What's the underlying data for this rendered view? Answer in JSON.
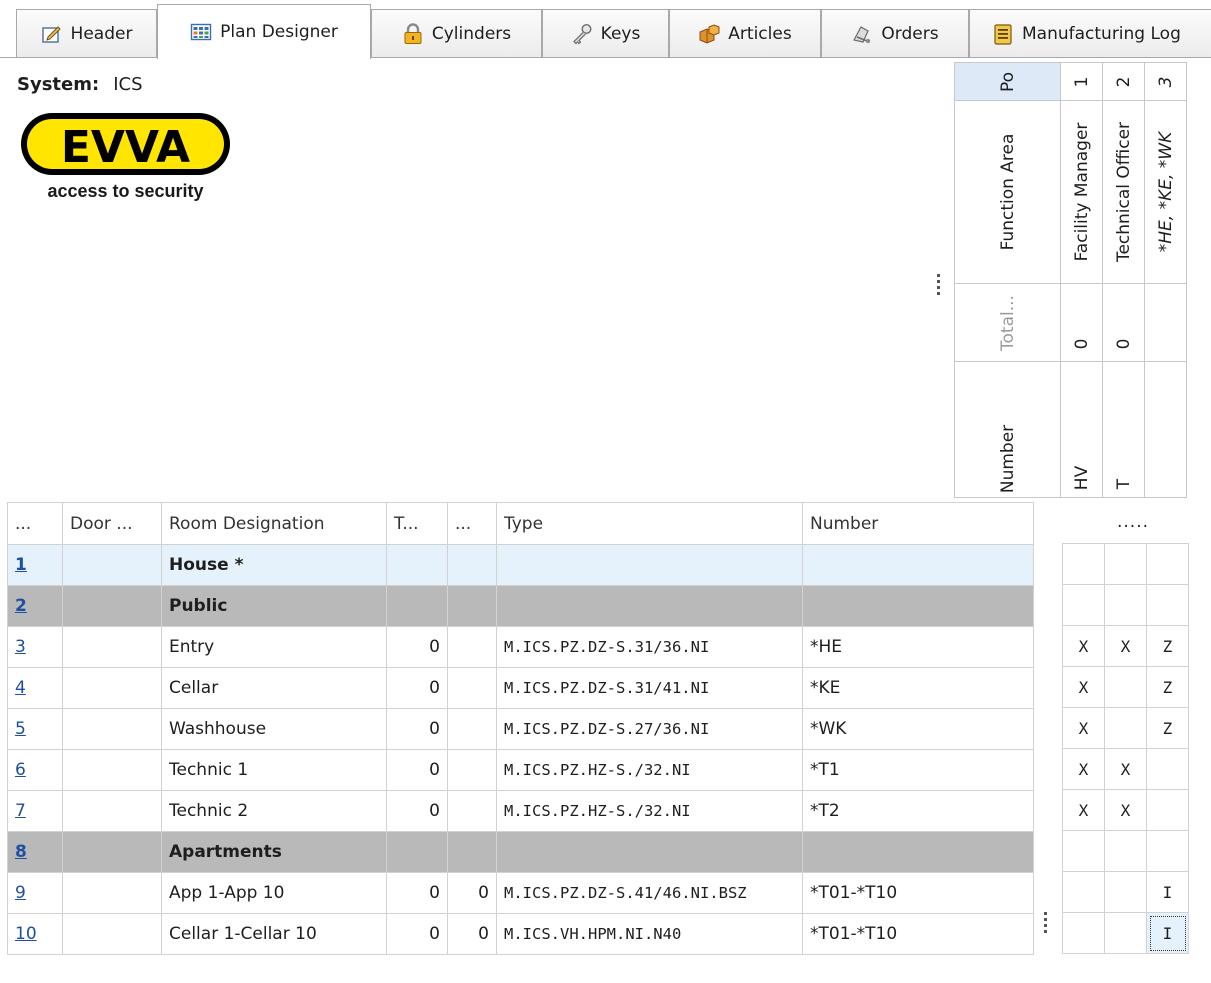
{
  "tabs": [
    {
      "label": "Header",
      "icon": "edit-icon"
    },
    {
      "label": "Plan Designer",
      "icon": "grid-icon",
      "active": true
    },
    {
      "label": "Cylinders",
      "icon": "padlock-icon"
    },
    {
      "label": "Keys",
      "icon": "key-icon"
    },
    {
      "label": "Articles",
      "icon": "boxes-icon"
    },
    {
      "label": "Orders",
      "icon": "truck-icon"
    },
    {
      "label": "Manufacturing Log",
      "icon": "log-icon"
    }
  ],
  "system": {
    "label": "System:",
    "value": "ICS"
  },
  "logo": {
    "brand": "EVVA",
    "tagline": "access to security",
    "accent": "#ffe500"
  },
  "matrix_header": {
    "row_labels": {
      "po": "Po",
      "function_area": "Function Area",
      "total": "Total...",
      "number": "Number"
    },
    "columns": [
      {
        "po": "1",
        "function_area": "Facility Manager",
        "total": "0",
        "number": "HV",
        "italic": false
      },
      {
        "po": "2",
        "function_area": "Technical Officer",
        "total": "0",
        "number": "T",
        "italic": false
      },
      {
        "po": "3",
        "function_area": "*HE, *KE, *WK",
        "total": "",
        "number": "",
        "italic": true
      }
    ]
  },
  "grid": {
    "headers": [
      "...",
      "Door ...",
      "Room Designation",
      "T...",
      "...",
      "Type",
      "Number"
    ],
    "rows": [
      {
        "idx": "1",
        "door": "",
        "room": "House *",
        "t": "",
        "c": "",
        "type": "",
        "number": "",
        "kind": "house",
        "marks": [
          "",
          "",
          ""
        ]
      },
      {
        "idx": "2",
        "door": "",
        "room": "Public",
        "t": "",
        "c": "",
        "type": "",
        "number": "",
        "kind": "group",
        "marks": [
          "",
          "",
          ""
        ]
      },
      {
        "idx": "3",
        "door": "",
        "room": "Entry",
        "t": "0",
        "c": "",
        "type": "M.ICS.PZ.DZ-S.31/36.NI",
        "number": "*HE",
        "kind": "row",
        "marks": [
          "X",
          "X",
          "Z"
        ]
      },
      {
        "idx": "4",
        "door": "",
        "room": "Cellar",
        "t": "0",
        "c": "",
        "type": "M.ICS.PZ.DZ-S.31/41.NI",
        "number": "*KE",
        "kind": "row",
        "marks": [
          "X",
          "",
          "Z"
        ]
      },
      {
        "idx": "5",
        "door": "",
        "room": "Washhouse",
        "t": "0",
        "c": "",
        "type": "M.ICS.PZ.DZ-S.27/36.NI",
        "number": "*WK",
        "kind": "row",
        "marks": [
          "X",
          "",
          "Z"
        ]
      },
      {
        "idx": "6",
        "door": "",
        "room": "Technic 1",
        "t": "0",
        "c": "",
        "type": "M.ICS.PZ.HZ-S./32.NI",
        "number": "*T1",
        "kind": "row",
        "marks": [
          "X",
          "X",
          ""
        ]
      },
      {
        "idx": "7",
        "door": "",
        "room": "Technic 2",
        "t": "0",
        "c": "",
        "type": "M.ICS.PZ.HZ-S./32.NI",
        "number": "*T2",
        "kind": "row",
        "marks": [
          "X",
          "X",
          ""
        ]
      },
      {
        "idx": "8",
        "door": "",
        "room": "Apartments",
        "t": "",
        "c": "",
        "type": "",
        "number": "",
        "kind": "group",
        "marks": [
          "",
          "",
          ""
        ]
      },
      {
        "idx": "9",
        "door": "",
        "room": "App 1-App 10",
        "t": "0",
        "c": "0",
        "type": "M.ICS.PZ.DZ-S.41/46.NI.BSZ",
        "number": "*T01-*T10",
        "kind": "row",
        "marks": [
          "",
          "",
          "I"
        ]
      },
      {
        "idx": "10",
        "door": "",
        "room": "Cellar 1-Cellar 10",
        "t": "0",
        "c": "0",
        "type": "M.ICS.VH.HPM.NI.N40",
        "number": "*T01-*T10",
        "kind": "row",
        "marks": [
          "",
          "",
          "I"
        ]
      }
    ]
  },
  "right_header_dots": "....."
}
